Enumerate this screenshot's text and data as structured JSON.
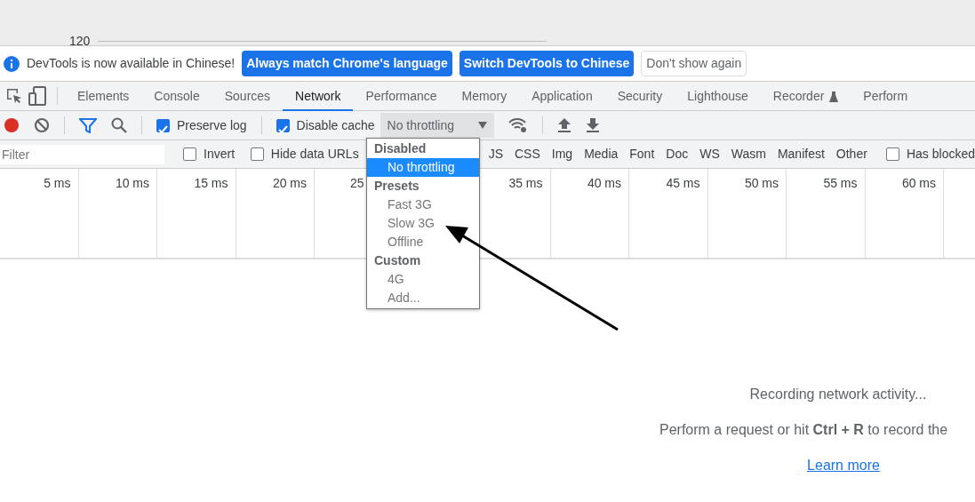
{
  "ruler": {
    "label": "120"
  },
  "infobar": {
    "message": "DevTools is now available in Chinese!",
    "buttons": [
      {
        "label": "Always match Chrome's language",
        "kind": "primary"
      },
      {
        "label": "Switch DevTools to Chinese",
        "kind": "primary"
      },
      {
        "label": "Don't show again",
        "kind": "plain"
      }
    ]
  },
  "tabs": [
    {
      "label": "Elements",
      "selected": false
    },
    {
      "label": "Console",
      "selected": false
    },
    {
      "label": "Sources",
      "selected": false
    },
    {
      "label": "Network",
      "selected": true
    },
    {
      "label": "Performance",
      "selected": false
    },
    {
      "label": "Memory",
      "selected": false
    },
    {
      "label": "Application",
      "selected": false
    },
    {
      "label": "Security",
      "selected": false
    },
    {
      "label": "Lighthouse",
      "selected": false
    },
    {
      "label": "Recorder",
      "selected": false,
      "experimental": true
    },
    {
      "label": "Perform",
      "selected": false
    }
  ],
  "toolbar": {
    "preserve_log": {
      "label": "Preserve log",
      "checked": true
    },
    "disable_cache": {
      "label": "Disable cache",
      "checked": true
    },
    "throttling": {
      "value": "No throttling"
    }
  },
  "filter_bar": {
    "placeholder": "Filter",
    "invert": {
      "label": "Invert",
      "checked": false
    },
    "hide_data_urls": {
      "label": "Hide data URLs",
      "checked": false
    },
    "types": [
      "JS",
      "CSS",
      "Img",
      "Media",
      "Font",
      "Doc",
      "WS",
      "Wasm",
      "Manifest",
      "Other"
    ],
    "has_blocked": {
      "label": "Has blocked",
      "checked": false
    }
  },
  "timeline": {
    "ticks": [
      {
        "label": "5 ms",
        "kind": "full"
      },
      {
        "label": "10 ms",
        "kind": "full"
      },
      {
        "label": "15 ms",
        "kind": "full"
      },
      {
        "label": "20 ms",
        "kind": "full"
      },
      {
        "label": "25",
        "kind": "cut"
      },
      {
        "label": "35 ms",
        "kind": "full"
      },
      {
        "label": "40 ms",
        "kind": "full"
      },
      {
        "label": "45 ms",
        "kind": "full"
      },
      {
        "label": "50 ms",
        "kind": "full"
      },
      {
        "label": "55 ms",
        "kind": "full"
      },
      {
        "label": "60 ms",
        "kind": "full"
      }
    ]
  },
  "dropdown": [
    {
      "kind": "group",
      "label": "Disabled"
    },
    {
      "kind": "option",
      "label": "No throttling",
      "selected": true
    },
    {
      "kind": "group",
      "label": "Presets"
    },
    {
      "kind": "option",
      "label": "Fast 3G",
      "selected": false
    },
    {
      "kind": "option",
      "label": "Slow 3G",
      "selected": false
    },
    {
      "kind": "option",
      "label": "Offline",
      "selected": false
    },
    {
      "kind": "group",
      "label": "Custom"
    },
    {
      "kind": "option",
      "label": "4G",
      "selected": false
    },
    {
      "kind": "option",
      "label": "Add...",
      "selected": false
    }
  ],
  "empty_state": {
    "title": "Recording network activity...",
    "hint": "Perform a request or hit **Ctrl + R** to record the",
    "link": "Learn more"
  }
}
